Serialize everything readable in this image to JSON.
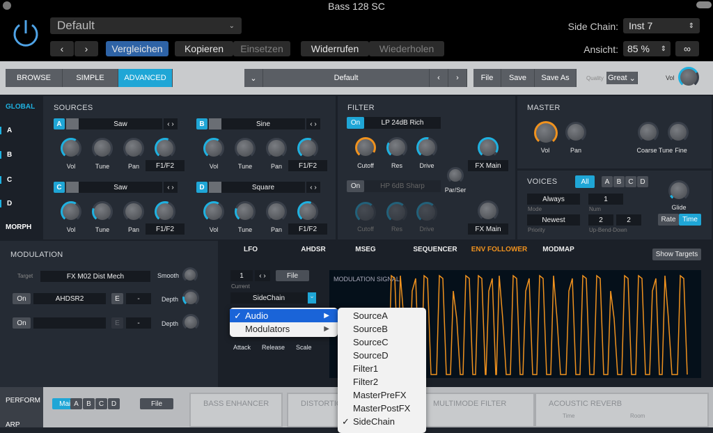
{
  "window": {
    "title": "Bass 128 SC"
  },
  "header": {
    "preset": "Default",
    "compare": "Vergleichen",
    "copy": "Kopieren",
    "paste": "Einsetzen",
    "undo": "Widerrufen",
    "redo": "Wiederholen",
    "sidechain_label": "Side Chain:",
    "sidechain_value": "Inst 7",
    "view_label": "Ansicht:",
    "view_value": "85 %"
  },
  "toolbar": {
    "tabs": [
      "BROWSE",
      "SIMPLE",
      "ADVANCED"
    ],
    "active_tab": "ADVANCED",
    "preset": "Default",
    "file": "File",
    "save": "Save",
    "save_as": "Save As",
    "quality_label": "Quality",
    "quality_value": "Great",
    "vol_label": "Vol"
  },
  "sidebar": {
    "items": [
      "GLOBAL",
      "A",
      "B",
      "C",
      "D",
      "MORPH"
    ]
  },
  "sources": {
    "title": "SOURCES",
    "slots": [
      {
        "id": "A",
        "wave": "Saw",
        "labels": [
          "Vol",
          "Tune",
          "Pan"
        ],
        "route": "F1/F2"
      },
      {
        "id": "B",
        "wave": "Sine",
        "labels": [
          "Vol",
          "Tune",
          "Pan"
        ],
        "route": "F1/F2"
      },
      {
        "id": "C",
        "wave": "Saw",
        "labels": [
          "Vol",
          "Tune",
          "Pan"
        ],
        "route": "F1/F2"
      },
      {
        "id": "D",
        "wave": "Square",
        "labels": [
          "Vol",
          "Tune",
          "Pan"
        ],
        "route": "F1/F2"
      }
    ]
  },
  "filter": {
    "title": "FILTER",
    "f1": {
      "on": "On",
      "type": "LP 24dB Rich",
      "labels": [
        "Cutoff",
        "Res",
        "Drive"
      ],
      "out": "FX Main"
    },
    "f2": {
      "on": "On",
      "type": "HP 6dB Sharp",
      "labels": [
        "Cutoff",
        "Res",
        "Drive"
      ],
      "out": "FX Main"
    },
    "parser": "Par/Ser"
  },
  "master": {
    "title": "MASTER",
    "labels": [
      "Vol",
      "Pan",
      "Coarse",
      "Tune",
      "Fine"
    ]
  },
  "voices": {
    "title": "VOICES",
    "all": "All",
    "groups": [
      "A",
      "B",
      "C",
      "D"
    ],
    "mode": "Always",
    "mode_label": "Mode",
    "num": "1",
    "num_label": "Num",
    "priority": "Newest",
    "priority_label": "Priority",
    "up": "2",
    "down": "2",
    "bend_label": "Up-Bend-Down",
    "glide": "Glide",
    "rate": "Rate",
    "time": "Time"
  },
  "modulation": {
    "title": "MODULATION",
    "target_label": "Target",
    "target": "FX M02 Dist Mech",
    "smooth": "Smooth",
    "rows": [
      {
        "on": "On",
        "source": "AHDSR2",
        "e": "E",
        "via": "-",
        "depth": "Depth"
      },
      {
        "on": "On",
        "source": "",
        "e": "E",
        "via": "-",
        "depth": "Depth"
      }
    ]
  },
  "mod_tabs": {
    "items": [
      "LFO",
      "AHDSR",
      "MSEG",
      "SEQUENCER",
      "ENV FOLLOWER",
      "MODMAP"
    ],
    "active": "ENV FOLLOWER",
    "show_targets": "Show Targets"
  },
  "env": {
    "number": "1",
    "file": "File",
    "current_label": "Current",
    "input": "SideChain",
    "attack": "Attack",
    "release": "Release",
    "scale": "Scale",
    "signal_title": "MODULATION SIGNAL",
    "signal_color": "#f0921e"
  },
  "menu": {
    "items": [
      {
        "label": "Audio",
        "checked": true
      },
      {
        "label": "Modulators",
        "checked": false
      }
    ],
    "submenu": [
      {
        "label": "SourceA"
      },
      {
        "label": "SourceB"
      },
      {
        "label": "SourceC"
      },
      {
        "label": "SourceD"
      },
      {
        "label": "Filter1"
      },
      {
        "label": "Filter2"
      },
      {
        "label": "MasterPreFX"
      },
      {
        "label": "MasterPostFX"
      },
      {
        "label": "SideChain",
        "checked": true
      }
    ]
  },
  "bottom": {
    "sidebar": [
      "PERFORM",
      "ARP"
    ],
    "groups": [
      "Main",
      "A",
      "B",
      "C",
      "D"
    ],
    "file": "File",
    "fx": [
      "BASS ENHANCER",
      "DISTORTION",
      "MULTIMODE FILTER",
      "ACOUSTIC REVERB"
    ],
    "reverb_labels": [
      "Time",
      "Room"
    ]
  },
  "colors": {
    "accent": "#1fa6d6",
    "highlight": "#f0921e",
    "menu_select": "#1a64d8"
  }
}
